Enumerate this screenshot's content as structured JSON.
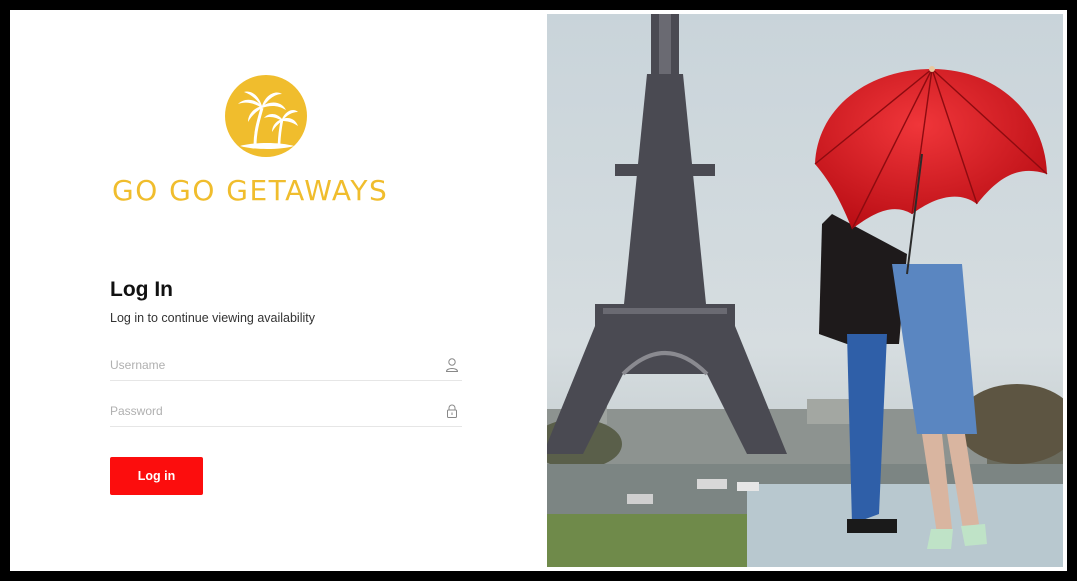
{
  "brand": {
    "name": "GO GO GETAWAYS",
    "color": "#f0bd2d",
    "logo_icon": "palm-tree-sun-icon"
  },
  "login": {
    "title": "Log In",
    "subtitle": "Log in to continue viewing availability",
    "username_placeholder": "Username",
    "username_value": "",
    "username_icon": "user-icon",
    "password_placeholder": "Password",
    "password_value": "",
    "password_icon": "lock-icon",
    "button_label": "Log in",
    "button_color": "#fc0d0d"
  },
  "hero": {
    "image": "Eiffel Tower with couple under red umbrella"
  }
}
